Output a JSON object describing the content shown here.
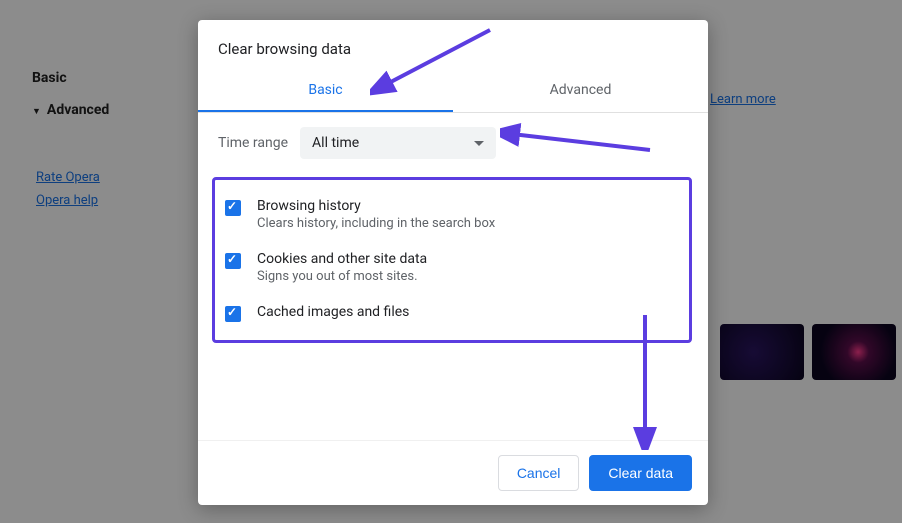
{
  "sidebar": {
    "items": [
      {
        "label": "Basic"
      },
      {
        "label": "Advanced"
      }
    ],
    "links": [
      {
        "label": "Rate Opera"
      },
      {
        "label": "Opera help"
      }
    ]
  },
  "main": {
    "learn_more": "Learn more"
  },
  "dialog": {
    "title": "Clear browsing data",
    "tabs": [
      {
        "label": "Basic",
        "active": true
      },
      {
        "label": "Advanced",
        "active": false
      }
    ],
    "time_range": {
      "label": "Time range",
      "value": "All time"
    },
    "options": [
      {
        "title": "Browsing history",
        "subtitle": "Clears history, including in the search box",
        "checked": true
      },
      {
        "title": "Cookies and other site data",
        "subtitle": "Signs you out of most sites.",
        "checked": true
      },
      {
        "title": "Cached images and files",
        "subtitle": "",
        "checked": true
      }
    ],
    "actions": {
      "cancel": "Cancel",
      "clear": "Clear data"
    }
  },
  "annotation": {
    "color": "#5b3de0"
  }
}
